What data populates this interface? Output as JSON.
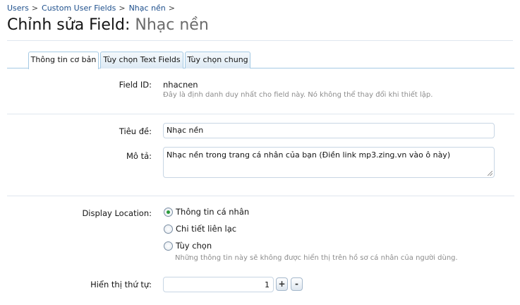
{
  "breadcrumb": [
    {
      "label": "Users"
    },
    {
      "label": "Custom User Fields"
    },
    {
      "label": "Nhạc nền"
    }
  ],
  "breadcrumb_separator": ">",
  "title": {
    "prefix": "Chỉnh sửa Field:",
    "name": "Nhạc nền"
  },
  "tabs": [
    {
      "label": "Thông tin cơ bản",
      "active": true
    },
    {
      "label": "Tùy chọn Text Fields",
      "active": false
    },
    {
      "label": "Tùy chọn chung",
      "active": false
    }
  ],
  "field_id": {
    "label": "Field ID:",
    "value": "nhacnen",
    "hint": "Đây là định danh duy nhất cho field này. Nó không thể thay đổi khi thiết lập."
  },
  "title_field": {
    "label": "Tiêu đề:",
    "value": "Nhạc nền"
  },
  "description_field": {
    "label": "Mô tả:",
    "value": "Nhạc nền trong trang cá nhân của bạn (Điền link mp3.zing.vn vào ô này)"
  },
  "display_location": {
    "label": "Display Location:",
    "options": [
      {
        "label": "Thông tin cá nhân",
        "checked": true
      },
      {
        "label": "Chi tiết liên lạc",
        "checked": false
      },
      {
        "label": "Tùy chọn",
        "checked": false
      }
    ],
    "hint": "Những thông tin này sẽ không được hiển thị trên hồ sơ cá nhân của người dùng."
  },
  "display_order": {
    "label": "Hiển thị thứ tự:",
    "value": "1",
    "plus_label": "+",
    "minus_label": "-"
  },
  "colors": {
    "link": "#1d4f8c",
    "tab_border": "#a5cae4",
    "radio_checked": "#2a9a3a"
  }
}
